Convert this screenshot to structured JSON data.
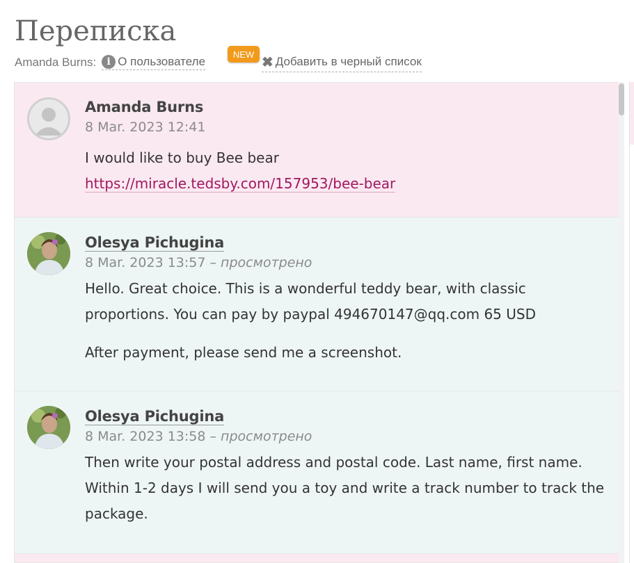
{
  "header": {
    "title": "Переписка",
    "user_label": "Amanda Burns:",
    "about_link": "О пользователе",
    "new_badge": "NEW",
    "blacklist_link": "Добавить в черный список",
    "icons": [
      "info-icon",
      "close-icon"
    ]
  },
  "colors": {
    "buyer_bg": "#fbe9f1",
    "seller_bg": "#eef6f5",
    "badge": "#f29a1c",
    "link": "#a01860"
  },
  "messages": [
    {
      "author": "Amanda Burns",
      "date": "8 Mar. 2023 12:41",
      "status": "",
      "lines": [
        "I would like to buy Bee bear"
      ],
      "link": "https://miracle.tedsby.com/157953/bee-bear"
    },
    {
      "author": "Olesya Pichugina",
      "date": "8 Mar. 2023 13:57",
      "status": "– просмотрено",
      "paragraph1": "Hello. Great choice. This is a wonderful teddy bear, with classic proportions. You can pay by paypal 494670147@qq.com 65 USD",
      "paragraph2": "After payment, please send me a screenshot."
    },
    {
      "author": "Olesya Pichugina",
      "date": "8 Mar. 2023 13:58",
      "status": "– просмотрено",
      "paragraph1": "Then write your postal address and postal code. Last name, first name. Within 1-2 days I will send you a toy and write a track number to track the package."
    }
  ]
}
